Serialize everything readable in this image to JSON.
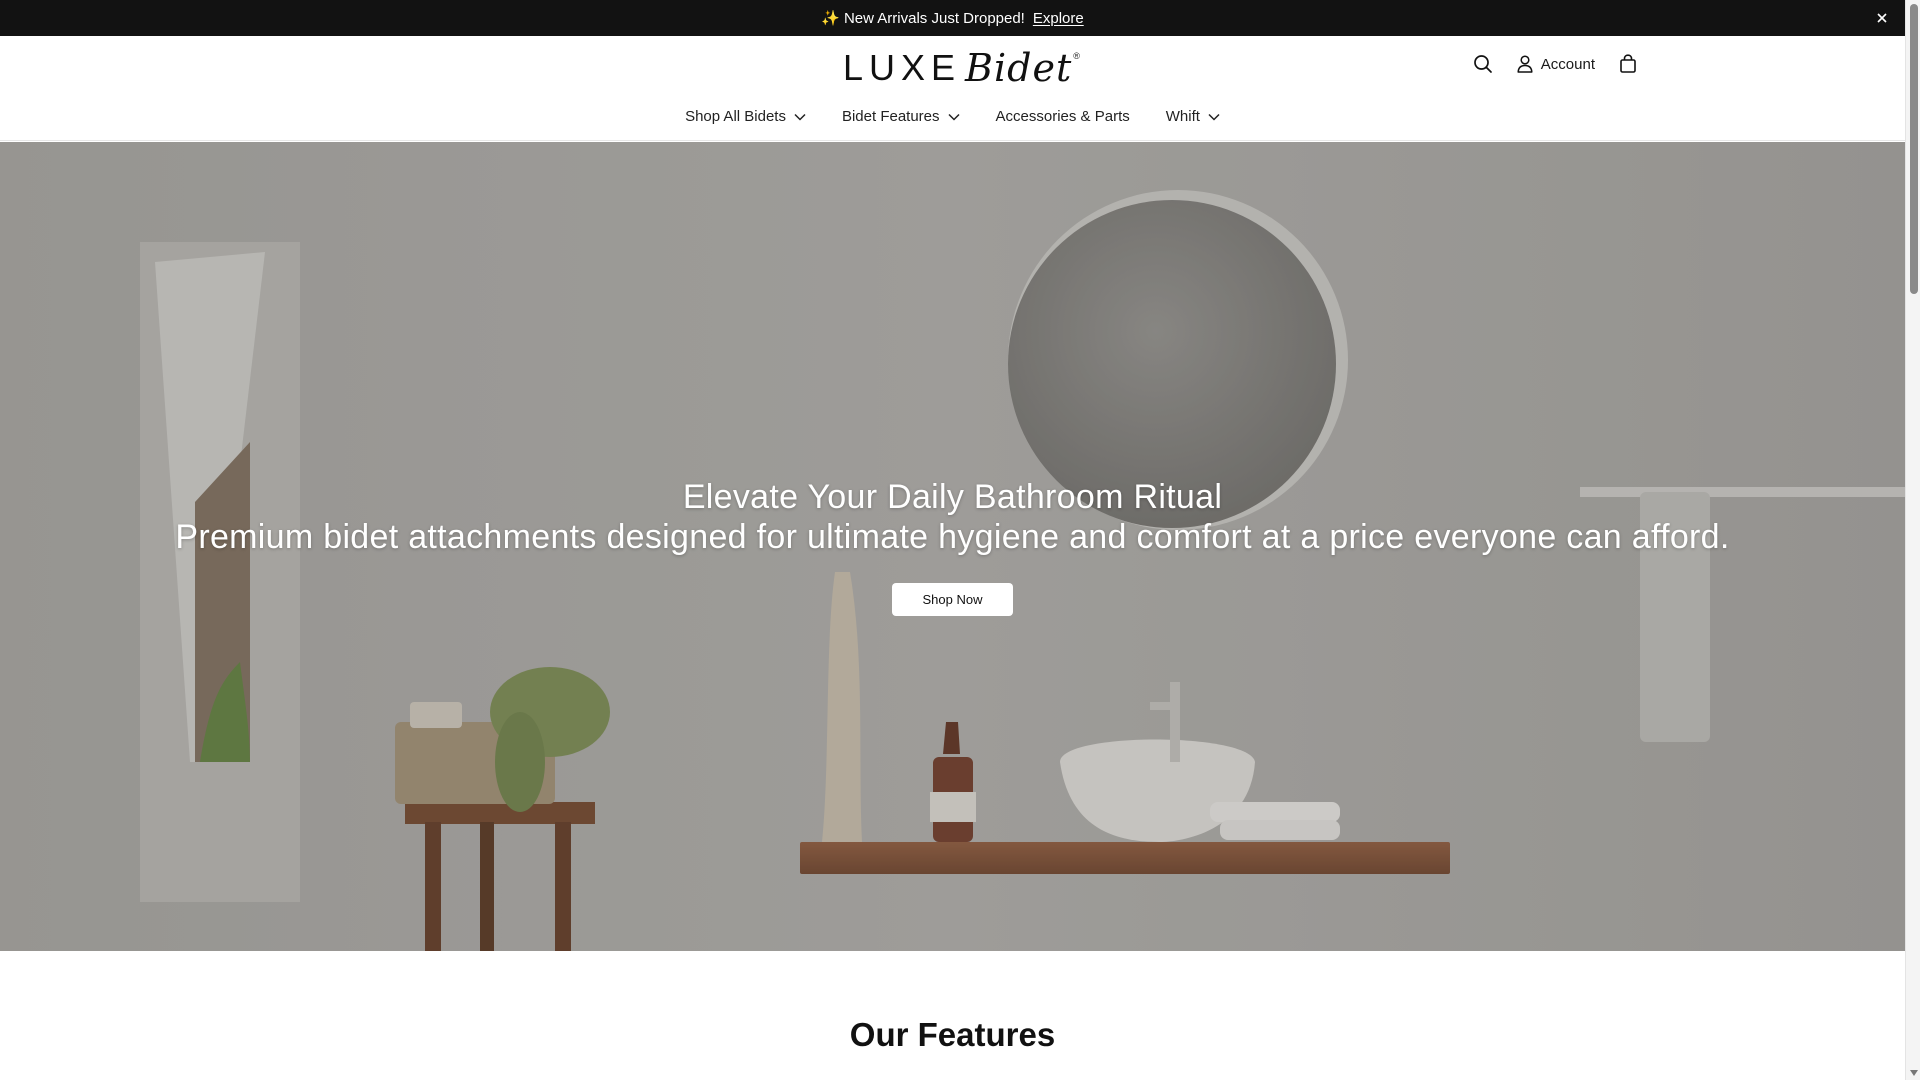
{
  "announcement": {
    "sparkle_icon": "✨",
    "text": "New Arrivals Just Dropped!",
    "link_label": "Explore",
    "close_icon": "×"
  },
  "header": {
    "logo": {
      "word1": "LUXE",
      "word2": "Bidet",
      "mark": "®"
    },
    "account_label": "Account",
    "icons": [
      "search-icon",
      "user-icon",
      "bag-icon"
    ]
  },
  "nav": {
    "items": [
      {
        "label": "Shop All Bidets",
        "has_dropdown": true
      },
      {
        "label": "Bidet Features",
        "has_dropdown": true
      },
      {
        "label": "Accessories & Parts",
        "has_dropdown": false
      },
      {
        "label": "Whift",
        "has_dropdown": true
      }
    ]
  },
  "hero": {
    "title": "Elevate Your Daily Bathroom Ritual",
    "subtitle": "Premium bidet attachments designed for ultimate hygiene and comfort at a price everyone can afford.",
    "cta_label": "Shop Now"
  },
  "features": {
    "title": "Our Features"
  },
  "colors": {
    "announcement_bg": "#121212",
    "text_dark": "#111111",
    "hero_overlay": "#9b9a98",
    "button_bg": "#ffffff"
  }
}
